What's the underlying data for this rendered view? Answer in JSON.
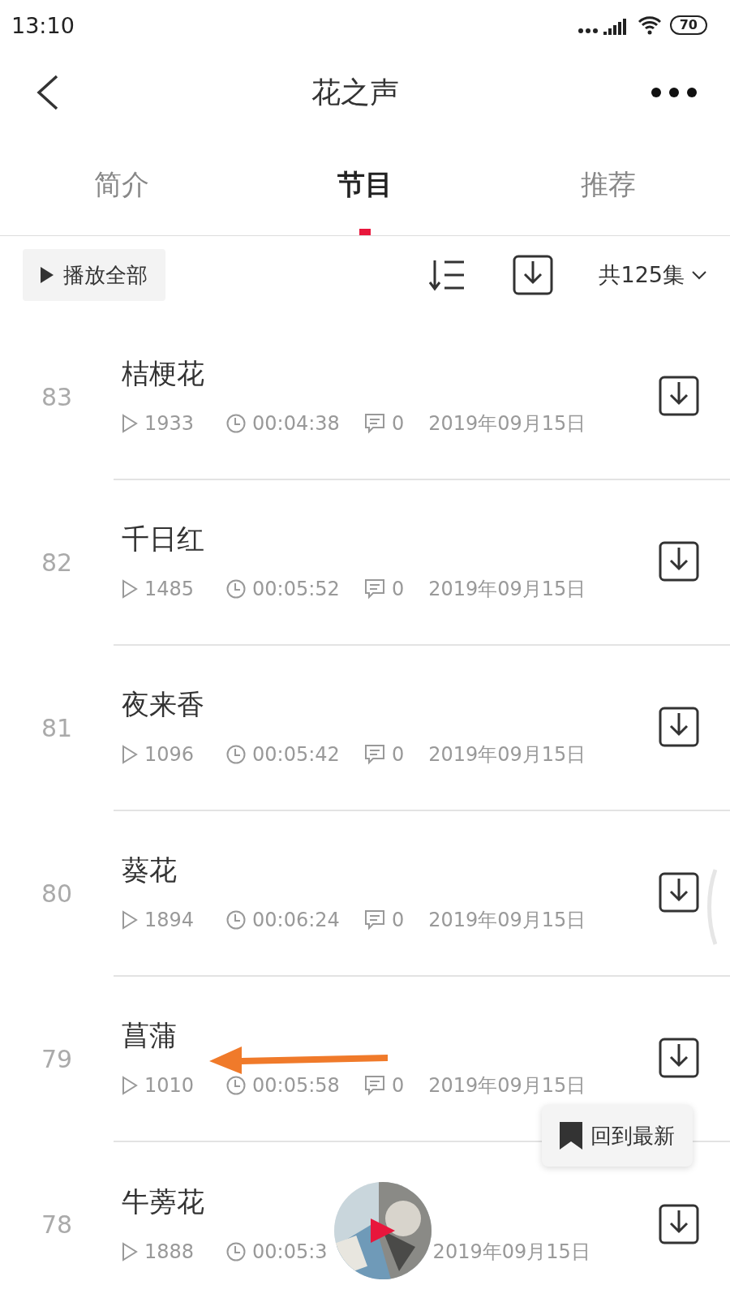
{
  "status_bar": {
    "time": "13:10",
    "battery": "70"
  },
  "header": {
    "title": "花之声"
  },
  "tabs": [
    {
      "label": "简介",
      "selected": false
    },
    {
      "label": "节目",
      "selected": true
    },
    {
      "label": "推荐",
      "selected": false
    }
  ],
  "toolbar": {
    "play_all": "播放全部",
    "count": "共125集"
  },
  "episodes": [
    {
      "number": "83",
      "title": "桔梗花",
      "plays": "1933",
      "duration": "00:04:38",
      "comments": "0",
      "date": "2019年09月15日"
    },
    {
      "number": "82",
      "title": "千日红",
      "plays": "1485",
      "duration": "00:05:52",
      "comments": "0",
      "date": "2019年09月15日"
    },
    {
      "number": "81",
      "title": "夜来香",
      "plays": "1096",
      "duration": "00:05:42",
      "comments": "0",
      "date": "2019年09月15日"
    },
    {
      "number": "80",
      "title": "葵花",
      "plays": "1894",
      "duration": "00:06:24",
      "comments": "0",
      "date": "2019年09月15日"
    },
    {
      "number": "79",
      "title": "菖蒲",
      "plays": "1010",
      "duration": "00:05:58",
      "comments": "0",
      "date": "2019年09月15日"
    },
    {
      "number": "78",
      "title": "牛蒡花",
      "plays": "1888",
      "duration": "00:05:3",
      "date": "2019年09月15日"
    }
  ],
  "back_to_latest": "回到最新"
}
